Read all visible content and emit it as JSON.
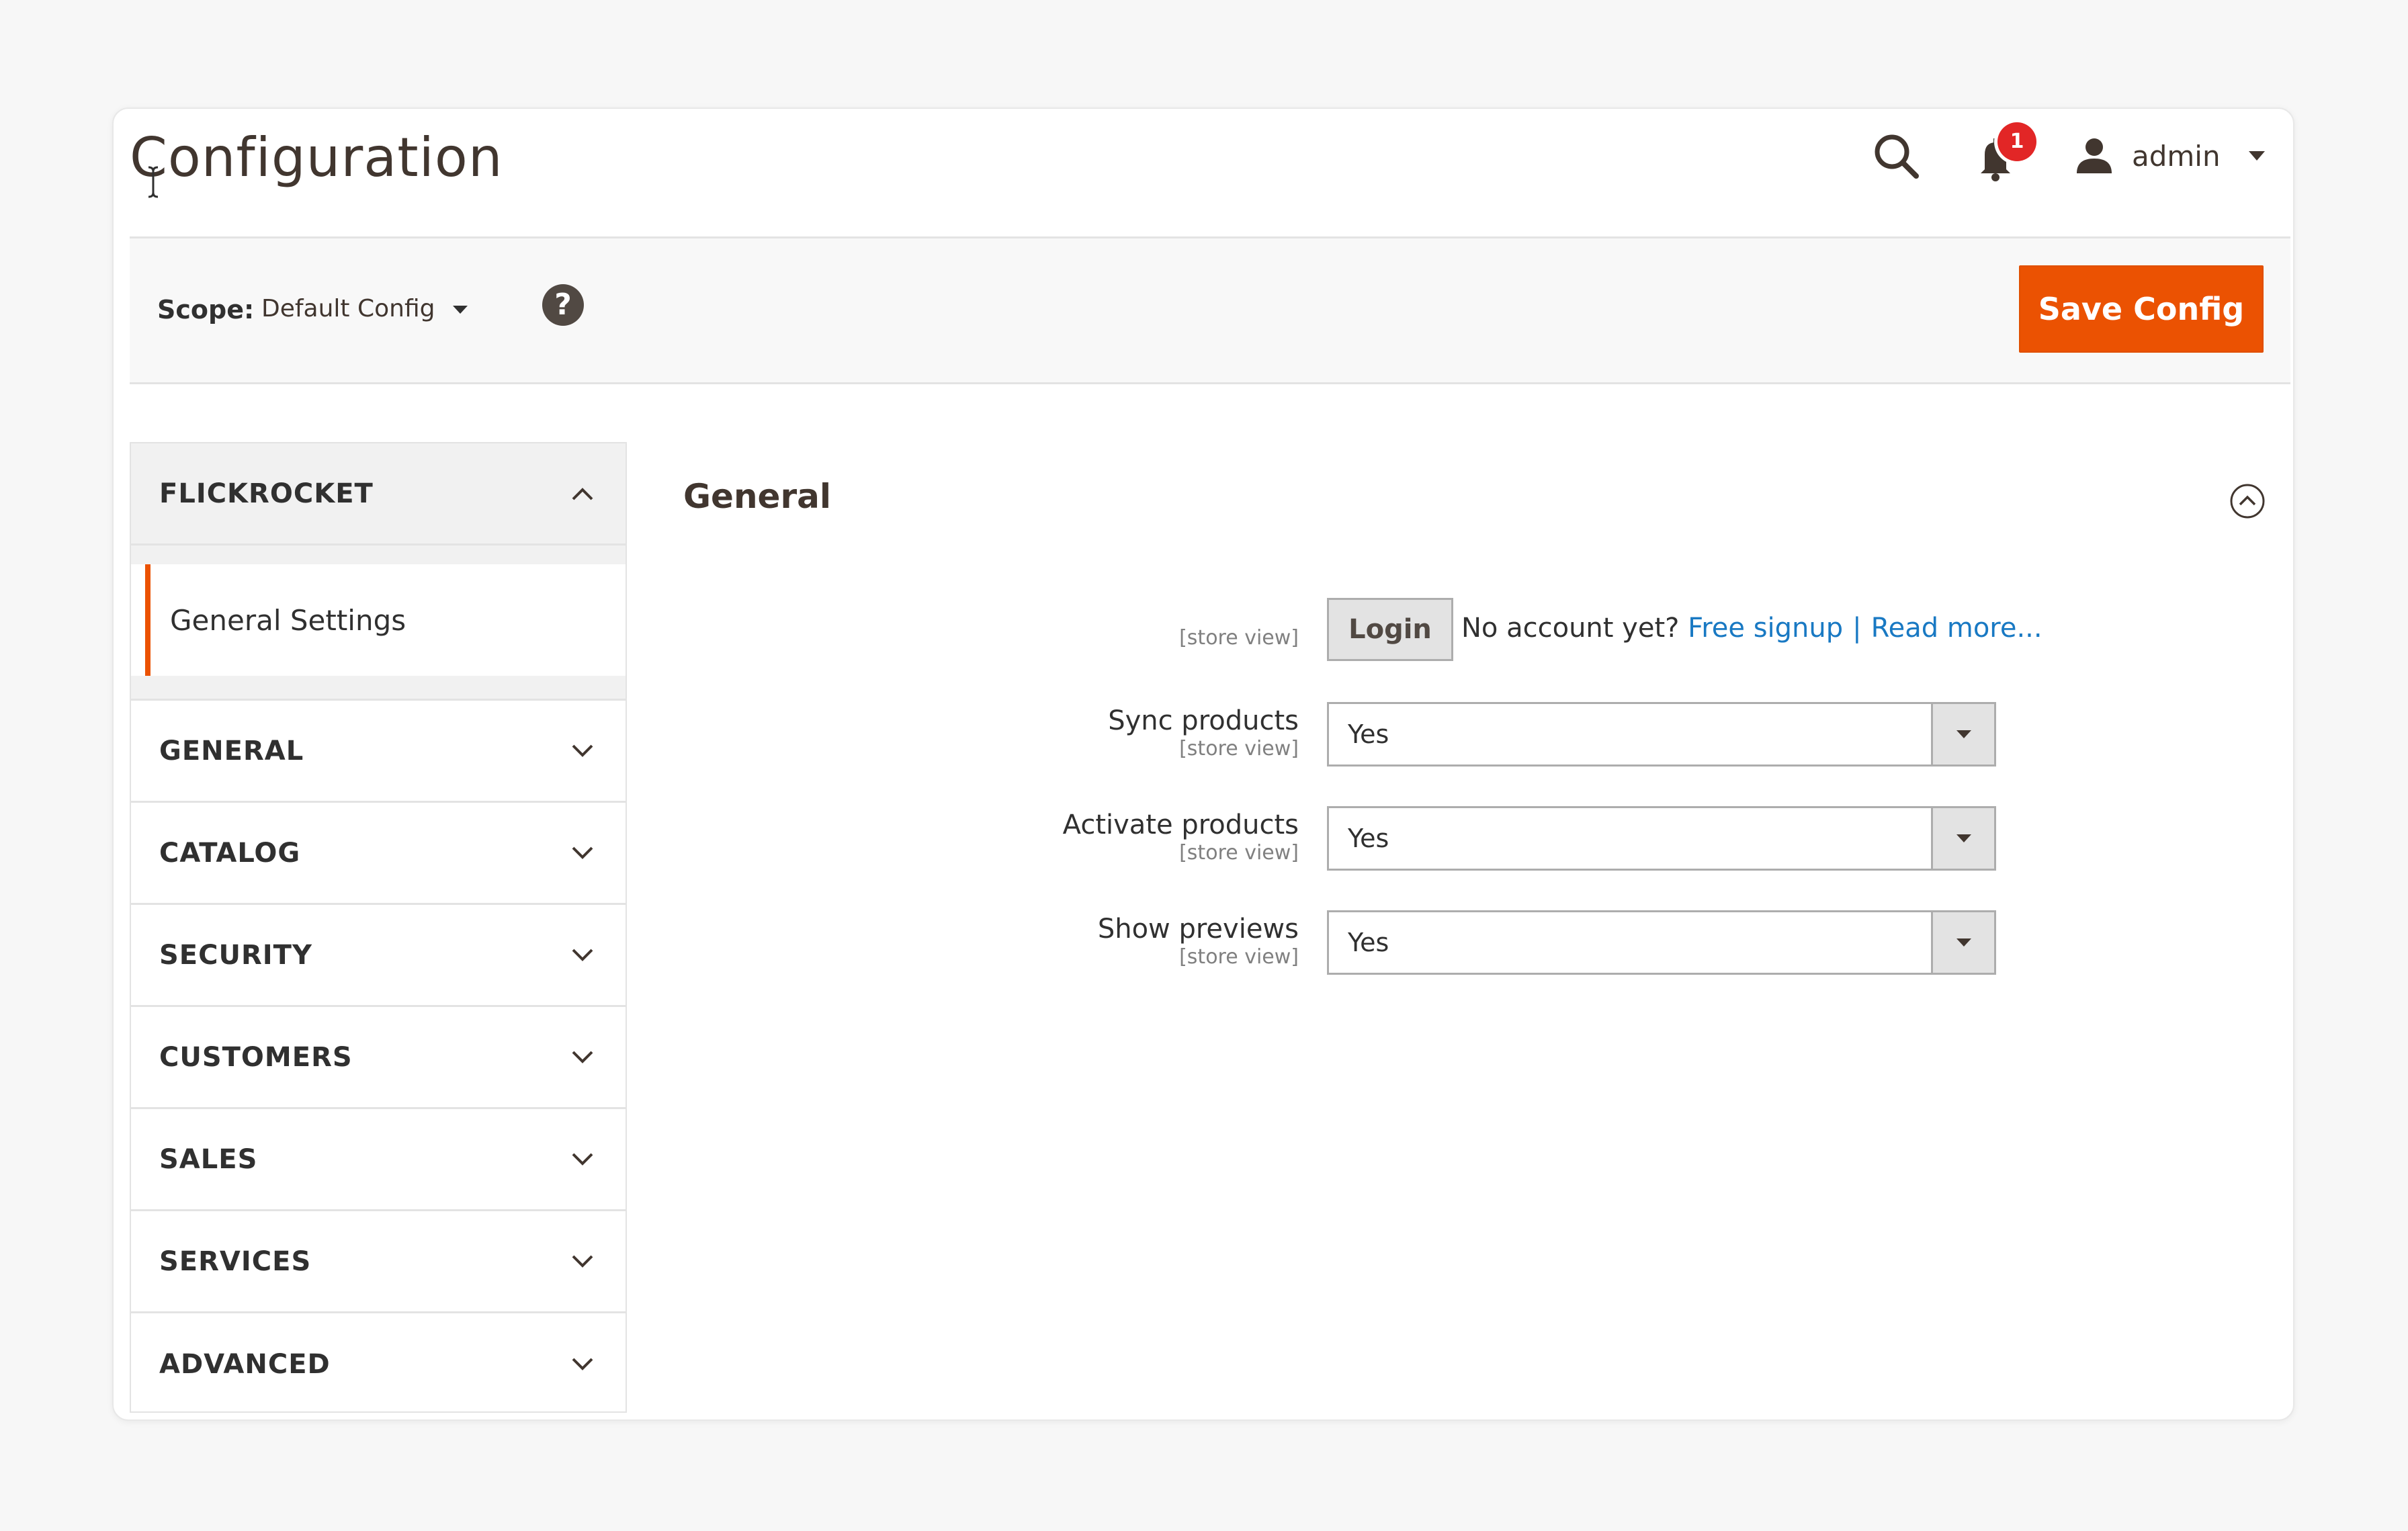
{
  "header": {
    "page_title": "Configuration",
    "notifications_count": "1",
    "user_name": "admin",
    "icons": [
      "search-icon",
      "bell-icon",
      "user-icon",
      "caret-down-icon"
    ]
  },
  "scope_bar": {
    "label": "Scope:",
    "selected": "Default Config",
    "help_symbol": "?",
    "save_button": "Save Config"
  },
  "sidebar": {
    "tabs": [
      {
        "label": "FLICKROCKET",
        "open": true,
        "items": [
          {
            "label": "General Settings",
            "active": true
          }
        ]
      },
      {
        "label": "GENERAL",
        "open": false
      },
      {
        "label": "CATALOG",
        "open": false
      },
      {
        "label": "SECURITY",
        "open": false
      },
      {
        "label": "CUSTOMERS",
        "open": false
      },
      {
        "label": "SALES",
        "open": false
      },
      {
        "label": "SERVICES",
        "open": false
      },
      {
        "label": "ADVANCED",
        "open": false
      }
    ]
  },
  "main": {
    "section_title": "General",
    "login_row": {
      "scope": "[store view]",
      "button": "Login",
      "note": "No account yet?",
      "signup_link": "Free signup",
      "separator": "|",
      "read_more_link": "Read more..."
    },
    "fields": [
      {
        "label": "Sync products",
        "scope": "[store view]",
        "value": "Yes"
      },
      {
        "label": "Activate products",
        "scope": "[store view]",
        "value": "Yes"
      },
      {
        "label": "Show previews",
        "scope": "[store view]",
        "value": "Yes"
      }
    ]
  },
  "colors": {
    "accent": "#eb5202",
    "link": "#1979c3",
    "badge": "#e22626",
    "text": "#303030"
  }
}
